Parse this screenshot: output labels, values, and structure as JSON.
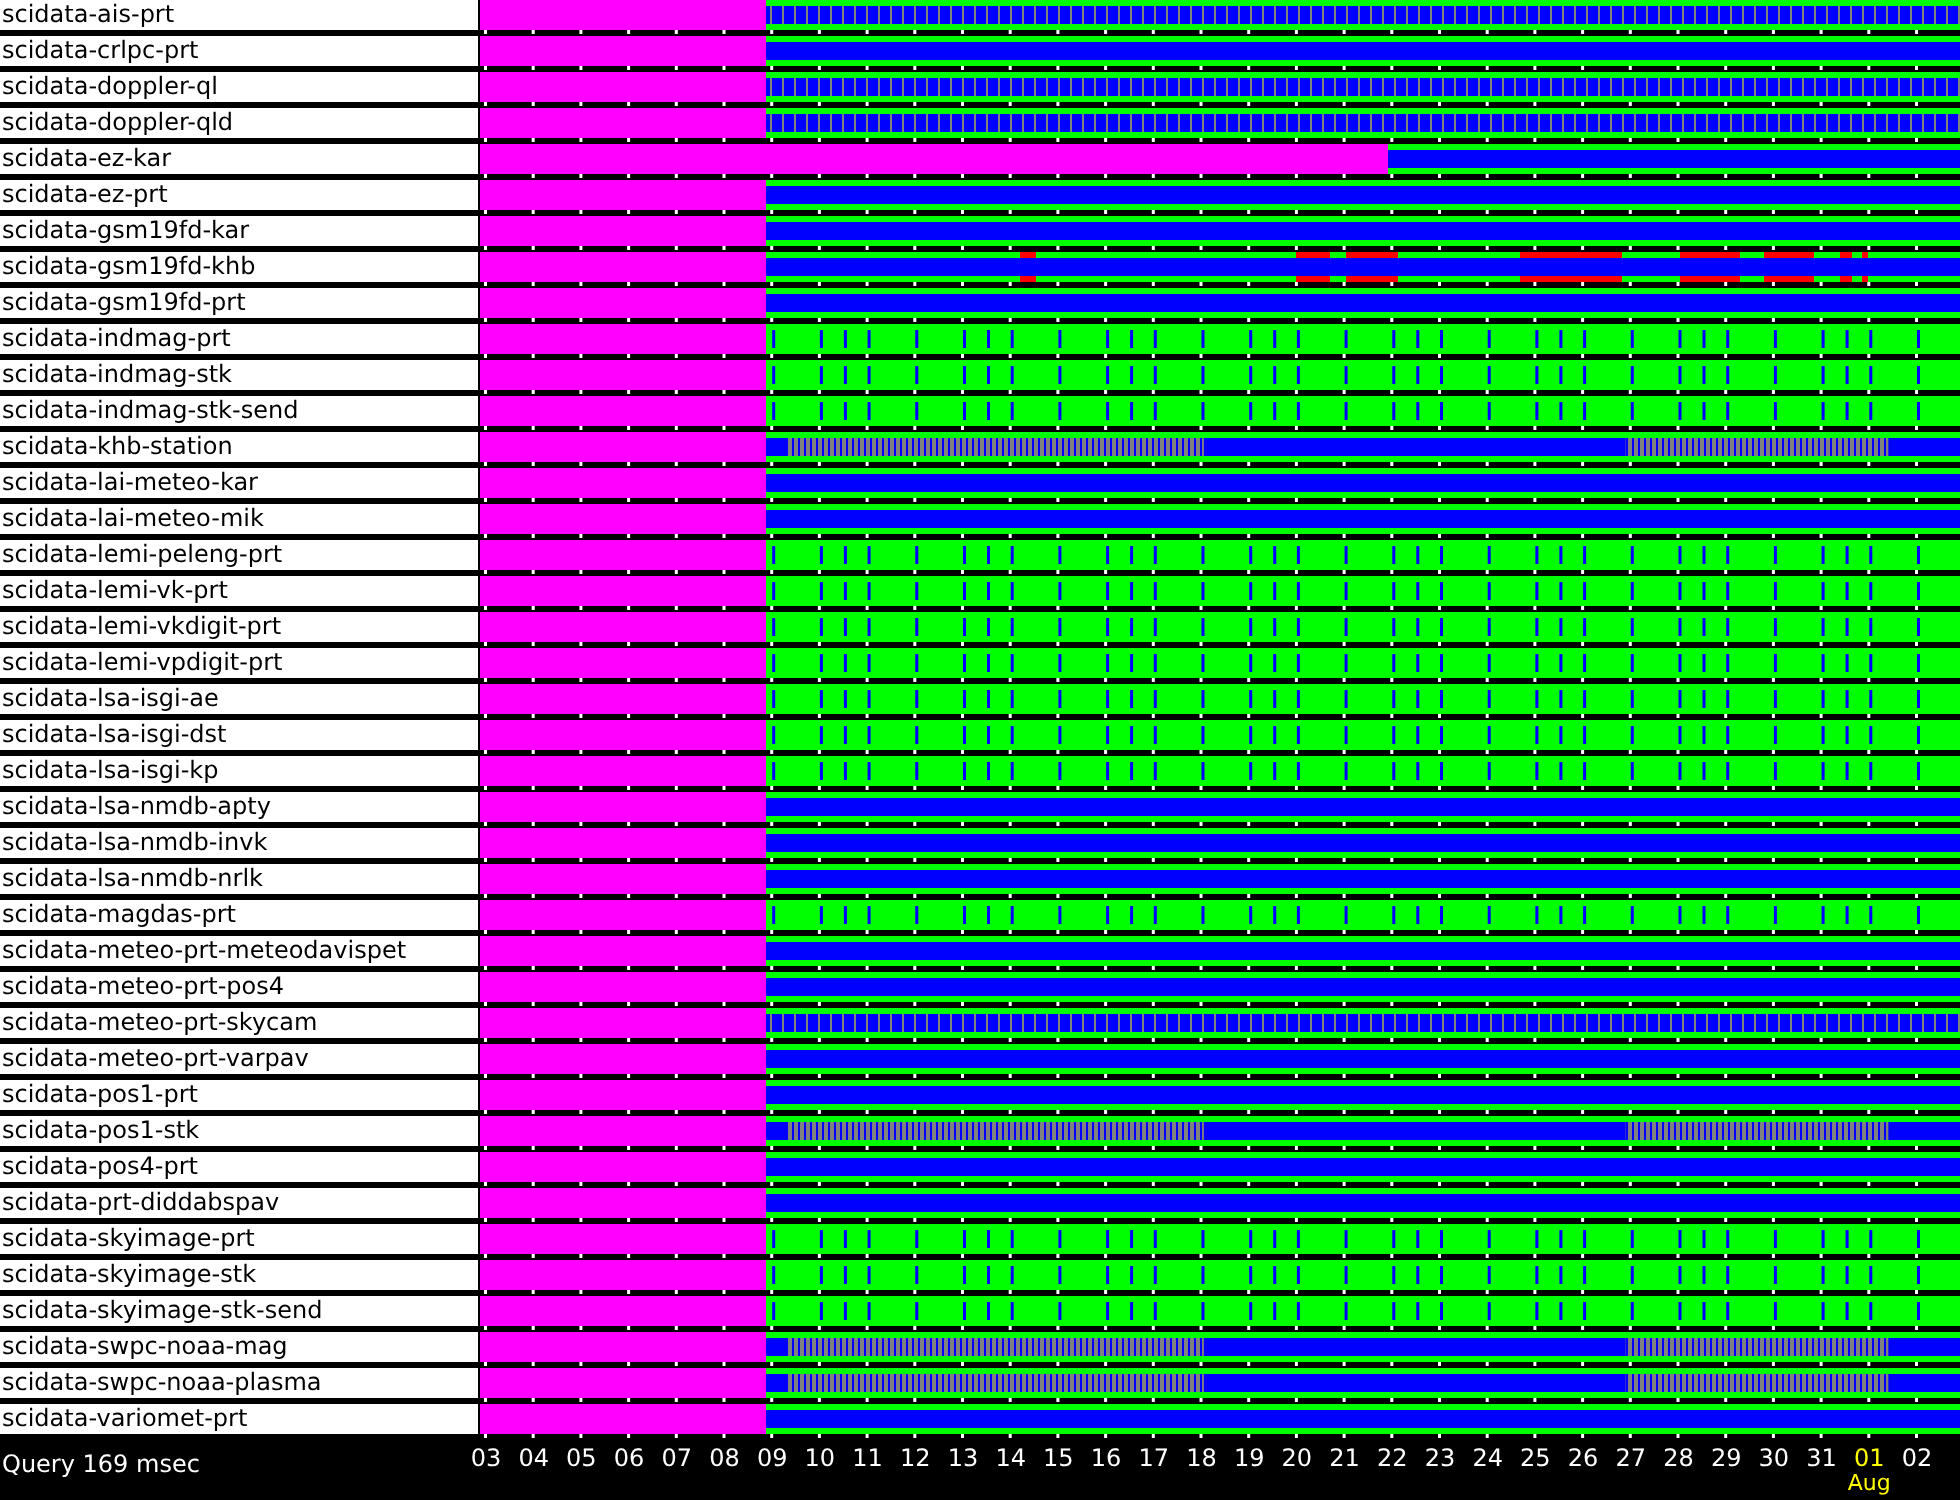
{
  "rows": [
    {
      "name": "scidata-ais-prt",
      "kind": "dashed"
    },
    {
      "name": "scidata-crlpc-prt",
      "kind": "band"
    },
    {
      "name": "scidata-doppler-ql",
      "kind": "dashed"
    },
    {
      "name": "scidata-doppler-qld",
      "kind": "dashed"
    },
    {
      "name": "scidata-ez-kar",
      "kind": "late"
    },
    {
      "name": "scidata-ez-prt",
      "kind": "band"
    },
    {
      "name": "scidata-gsm19fd-kar",
      "kind": "band"
    },
    {
      "name": "scidata-gsm19fd-khb",
      "kind": "alerts"
    },
    {
      "name": "scidata-gsm19fd-prt",
      "kind": "band"
    },
    {
      "name": "scidata-indmag-prt",
      "kind": "ticks"
    },
    {
      "name": "scidata-indmag-stk",
      "kind": "ticks"
    },
    {
      "name": "scidata-indmag-stk-send",
      "kind": "ticks"
    },
    {
      "name": "scidata-khb-station",
      "kind": "mixed"
    },
    {
      "name": "scidata-lai-meteo-kar",
      "kind": "band"
    },
    {
      "name": "scidata-lai-meteo-mik",
      "kind": "band"
    },
    {
      "name": "scidata-lemi-peleng-prt",
      "kind": "ticks"
    },
    {
      "name": "scidata-lemi-vk-prt",
      "kind": "ticks"
    },
    {
      "name": "scidata-lemi-vkdigit-prt",
      "kind": "ticks"
    },
    {
      "name": "scidata-lemi-vpdigit-prt",
      "kind": "ticks"
    },
    {
      "name": "scidata-lsa-isgi-ae",
      "kind": "ticks"
    },
    {
      "name": "scidata-lsa-isgi-dst",
      "kind": "ticks"
    },
    {
      "name": "scidata-lsa-isgi-kp",
      "kind": "ticks"
    },
    {
      "name": "scidata-lsa-nmdb-apty",
      "kind": "band"
    },
    {
      "name": "scidata-lsa-nmdb-invk",
      "kind": "band"
    },
    {
      "name": "scidata-lsa-nmdb-nrlk",
      "kind": "band"
    },
    {
      "name": "scidata-magdas-prt",
      "kind": "ticks"
    },
    {
      "name": "scidata-meteo-prt-meteodavispet",
      "kind": "band"
    },
    {
      "name": "scidata-meteo-prt-pos4",
      "kind": "band"
    },
    {
      "name": "scidata-meteo-prt-skycam",
      "kind": "dashed"
    },
    {
      "name": "scidata-meteo-prt-varpav",
      "kind": "band"
    },
    {
      "name": "scidata-pos1-prt",
      "kind": "band"
    },
    {
      "name": "scidata-pos1-stk",
      "kind": "mixed"
    },
    {
      "name": "scidata-pos4-prt",
      "kind": "band"
    },
    {
      "name": "scidata-prt-diddabspav",
      "kind": "band"
    },
    {
      "name": "scidata-skyimage-prt",
      "kind": "ticks"
    },
    {
      "name": "scidata-skyimage-stk",
      "kind": "ticks"
    },
    {
      "name": "scidata-skyimage-stk-send",
      "kind": "ticks"
    },
    {
      "name": "scidata-swpc-noaa-mag",
      "kind": "mixed"
    },
    {
      "name": "scidata-swpc-noaa-plasma",
      "kind": "mixed"
    },
    {
      "name": "scidata-variomet-prt",
      "kind": "band"
    }
  ],
  "status": "Query 169 msec",
  "days": [
    {
      "label": "03"
    },
    {
      "label": "04"
    },
    {
      "label": "05"
    },
    {
      "label": "06"
    },
    {
      "label": "07"
    },
    {
      "label": "08"
    },
    {
      "label": "09"
    },
    {
      "label": "10"
    },
    {
      "label": "11"
    },
    {
      "label": "12"
    },
    {
      "label": "13"
    },
    {
      "label": "14"
    },
    {
      "label": "15"
    },
    {
      "label": "16"
    },
    {
      "label": "17"
    },
    {
      "label": "18"
    },
    {
      "label": "19"
    },
    {
      "label": "20"
    },
    {
      "label": "21"
    },
    {
      "label": "22"
    },
    {
      "label": "23"
    },
    {
      "label": "24"
    },
    {
      "label": "25"
    },
    {
      "label": "26"
    },
    {
      "label": "27"
    },
    {
      "label": "28"
    },
    {
      "label": "29"
    },
    {
      "label": "30"
    },
    {
      "label": "31"
    },
    {
      "label": "01",
      "month": "Aug"
    },
    {
      "label": "02"
    }
  ]
}
